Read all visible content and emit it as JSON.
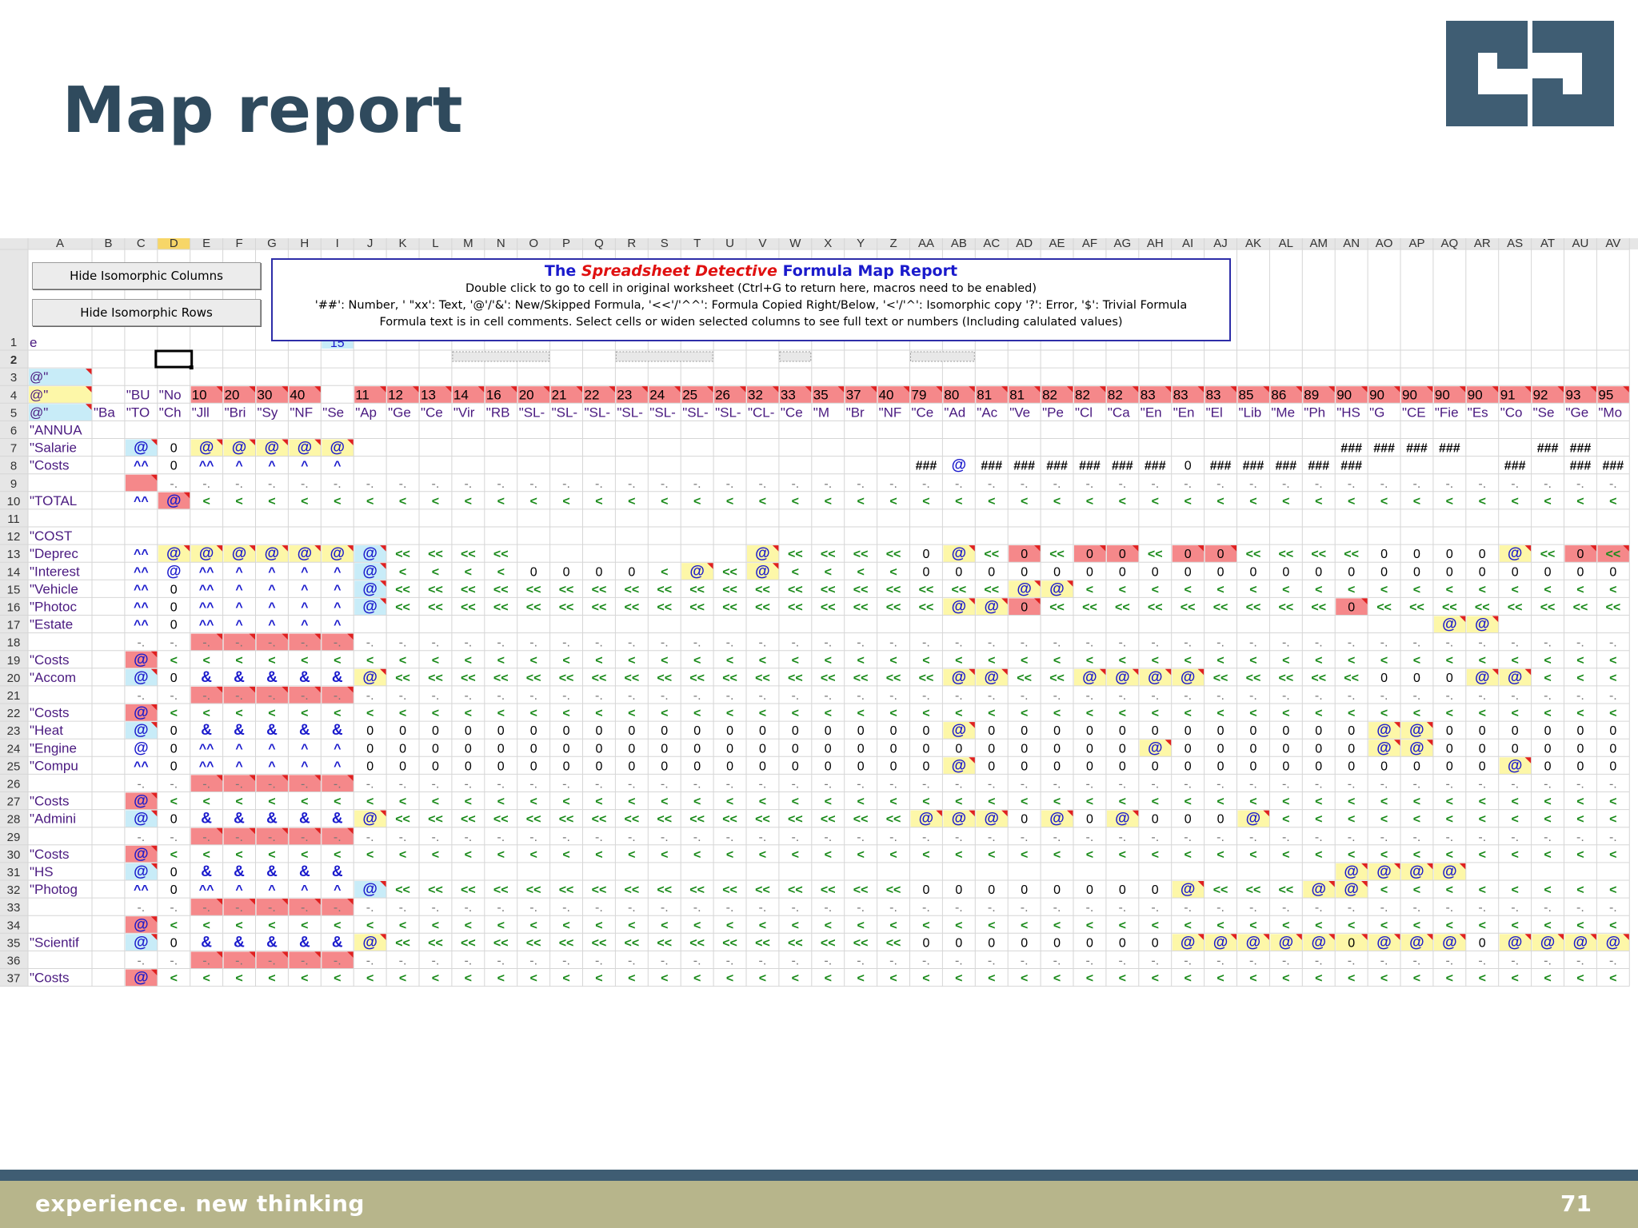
{
  "slide": {
    "title": "Map report",
    "footer_tagline": "experience. new thinking",
    "page_number": "71",
    "colors": {
      "title": "#2f4a5d",
      "footer_bar": "#b7b58b",
      "footer_rule": "#3f5d73",
      "logo": "#3f5d73"
    }
  },
  "logo": {
    "icon": "company-logo-icon"
  },
  "sheet": {
    "buttons": {
      "hide_columns": "Hide Isomorphic Columns",
      "hide_rows": "Hide Isomorphic Rows"
    },
    "legend": {
      "title_prefix": "The",
      "title_emphasis": "Spreadsheet Detective",
      "title_suffix": "Formula Map Report",
      "line1": "Double click to go to cell in original worksheet (Ctrl+G to return here, macros need to be enabled)",
      "line2": "'##': Number, ' \"xx': Text, '@'/'&': New/Skipped Formula, '<<'/'^^': Formula Copied Right/Below, '<'/'^': Isomorphic copy '?': Error, '$': Trivial Formula",
      "line3": "Formula text is in cell comments. Select cells or widen selected columns to see full text or numbers (Including calulated values)"
    },
    "column_headers": [
      "A",
      "B",
      "C",
      "D",
      "E",
      "F",
      "G",
      "H",
      "I",
      "J",
      "K",
      "L",
      "M",
      "N",
      "O",
      "P",
      "Q",
      "R",
      "S",
      "T",
      "U",
      "V",
      "W",
      "X",
      "Y",
      "Z",
      "AA",
      "AB",
      "AC",
      "AD",
      "AE",
      "AF",
      "AG",
      "AH",
      "AI",
      "AJ",
      "AK",
      "AL",
      "AM",
      "AN",
      "AO",
      "AP",
      "AQ",
      "AR",
      "AS",
      "AT",
      "AU",
      "AV"
    ],
    "selected_column": "D",
    "selected_row": "2",
    "col_a_labels": {
      "1": "e",
      "3": "@\"",
      "4": "@\"",
      "5": "@\"",
      "6": "\"ANNUA",
      "7": "\"Salarie",
      "8": "\"Costs",
      "10": "\"TOTAL",
      "12": "\"COST",
      "13": "\"Deprec",
      "14": "\"Interest",
      "15": "\"Vehicle",
      "16": "\"Photoc",
      "17": "\"Estate",
      "19": "\"Costs",
      "20": "\"Accom",
      "22": "\"Costs",
      "23": "\"Heat",
      "24": "\"Engine",
      "25": "\"Compu",
      "27": "\"Costs",
      "28": "\"Admini",
      "30": "\"Costs",
      "31": "\"HS",
      "32": "\"Photog",
      "35": "\"Scientif",
      "37": "\"Costs"
    },
    "row4_values": [
      "\"BU",
      "\"No",
      "10",
      "20",
      "30",
      "40",
      "",
      "11",
      "12",
      "13",
      "14",
      "16",
      "20",
      "21",
      "22",
      "23",
      "24",
      "25",
      "26",
      "32",
      "33",
      "35",
      "37",
      "40",
      "79",
      "80",
      "81",
      "81",
      "82",
      "82",
      "82",
      "83",
      "83",
      "83",
      "85",
      "86",
      "89",
      "90",
      "90",
      "90",
      "90",
      "90",
      "91",
      "92",
      "93",
      "95"
    ],
    "row5_values": [
      "\"Ba",
      "\"TO",
      "\"Ch",
      "\"Jll",
      "\"Bri",
      "\"Sy",
      "\"NF",
      "\"Se",
      "\"Ap",
      "\"Ge",
      "\"Ce",
      "\"Vir",
      "\"RB",
      "\"SL-",
      "\"SL-",
      "\"SL-",
      "\"SL-",
      "\"SL-",
      "\"SL-",
      "\"SL-",
      "\"CL-",
      "\"Ce",
      "\"M",
      "\"Br",
      "\"NF",
      "\"Ce",
      "\"Ad",
      "\"Ac",
      "\"Ve",
      "\"Pe",
      "\"Cl",
      "\"Ca",
      "\"En",
      "\"En",
      "\"El",
      "\"Lib",
      "\"Me",
      "\"Ph",
      "\"HS",
      "\"G",
      "\"CE",
      "\"Fie",
      "\"Es",
      "\"Co",
      "\"Se",
      "\"Ge",
      "\"Mo"
    ],
    "i1_value": "15",
    "colors": {
      "header_bg": "#e6e6e6",
      "grid": "#d6d6d6",
      "selected_header": "#f7d668",
      "red_fill": "#f5888a",
      "yellow_fill": "#fdf7a8",
      "cyan_fill": "#c8ecf8",
      "new_formula": "#1a1acc",
      "copy_marker": "#1a8a1a",
      "number": "#000000",
      "text": "#4a1a80"
    }
  }
}
